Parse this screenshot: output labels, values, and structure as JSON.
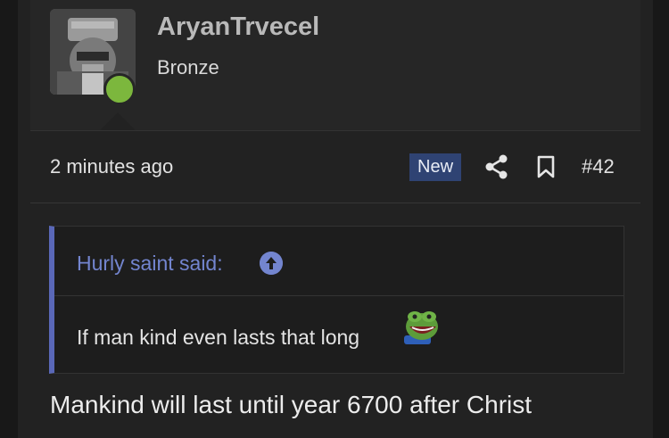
{
  "user": {
    "name": "AryanTrvecel",
    "title": "Bronze"
  },
  "meta": {
    "time": "2 minutes ago",
    "badge": "New",
    "post_number": "#42"
  },
  "quote": {
    "author": "Hurly saint said:",
    "text": "If man kind even lasts that long"
  },
  "message": "Mankind will last until year 6700 after Christ",
  "colors": {
    "accent": "#5a68b8",
    "badge_bg": "#2f4373",
    "online": "#7cb73d"
  },
  "icons": [
    "share-icon",
    "bookmark-icon",
    "arrow-up-circle-icon",
    "pepe-laugh-emoji"
  ]
}
